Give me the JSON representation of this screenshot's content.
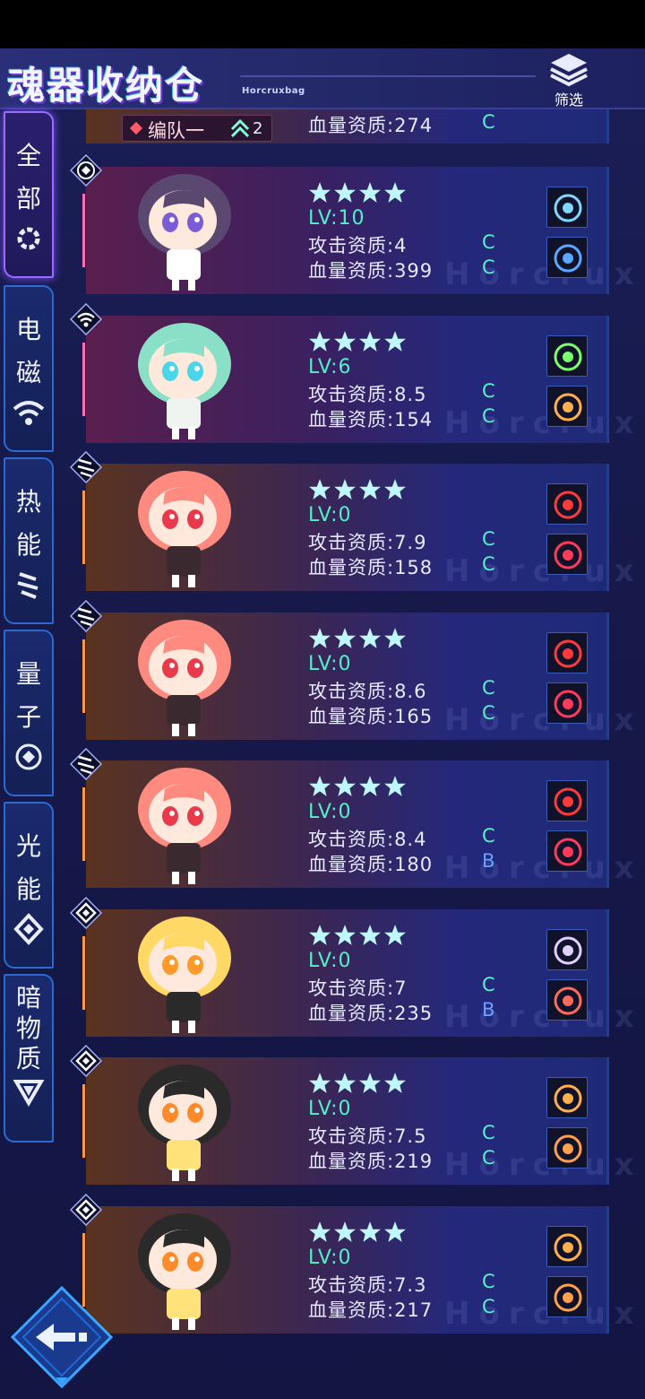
{
  "header": {
    "title": "魂器收纳仓",
    "subtitle": "Horcruxbag",
    "filter_label": "筛选"
  },
  "sidebar": {
    "tabs": [
      {
        "label": "全部",
        "icon": "all-gear-icon",
        "active": true
      },
      {
        "label": "电磁",
        "icon": "wifi-icon",
        "active": false
      },
      {
        "label": "热能",
        "icon": "heat-slashes-icon",
        "active": false
      },
      {
        "label": "量子",
        "icon": "quantum-icon",
        "active": false
      },
      {
        "label": "光能",
        "icon": "diamond-icon",
        "active": false
      },
      {
        "label": "暗物质",
        "icon": "dark-matter-icon",
        "active": false
      }
    ]
  },
  "partial_card": {
    "team_label": "编队一",
    "team_rank": "2",
    "stat_label": "血量资质:274",
    "grade": "C"
  },
  "watermark": "Horcrux",
  "cards": [
    {
      "element": "quantum-icon",
      "stars": 4,
      "level": "LV:10",
      "attack": "攻击资质:4",
      "attack_grade": "C",
      "hp": "血量资质:399",
      "hp_grade": "C",
      "skills": [
        "vortex-eye-icon",
        "shield-emblem-icon"
      ]
    },
    {
      "element": "wifi-icon",
      "stars": 4,
      "level": "LV:6",
      "attack": "攻击资质:8.5",
      "attack_grade": "C",
      "hp": "血量资质:154",
      "hp_grade": "C",
      "skills": [
        "green-gear-icon",
        "sword-up-icon"
      ]
    },
    {
      "element": "heat-slashes-icon",
      "stars": 4,
      "level": "LV:0",
      "attack": "攻击资质:7.9",
      "attack_grade": "C",
      "hp": "血量资质:158",
      "hp_grade": "C",
      "skills": [
        "red-figure-icon",
        "broken-heart-icon"
      ]
    },
    {
      "element": "heat-slashes-icon",
      "stars": 4,
      "level": "LV:0",
      "attack": "攻击资质:8.6",
      "attack_grade": "C",
      "hp": "血量资质:165",
      "hp_grade": "C",
      "skills": [
        "red-figure-icon",
        "broken-heart-icon"
      ]
    },
    {
      "element": "heat-slashes-icon",
      "stars": 4,
      "level": "LV:0",
      "attack": "攻击资质:8.4",
      "attack_grade": "C",
      "hp": "血量资质:180",
      "hp_grade": "B",
      "skills": [
        "red-figure-icon",
        "broken-heart-icon"
      ]
    },
    {
      "element": "diamond-icon",
      "stars": 4,
      "level": "LV:0",
      "attack": "攻击资质:7",
      "attack_grade": "C",
      "hp": "血量资质:235",
      "hp_grade": "B",
      "skills": [
        "purple-spirit-icon",
        "red-claw-icon"
      ]
    },
    {
      "element": "diamond-icon",
      "stars": 4,
      "level": "LV:0",
      "attack": "攻击资质:7.5",
      "attack_grade": "C",
      "hp": "血量资质:219",
      "hp_grade": "C",
      "skills": [
        "sword-up-icon",
        "crossed-swords-icon"
      ]
    },
    {
      "element": "diamond-icon",
      "stars": 4,
      "level": "LV:0",
      "attack": "攻击资质:7.3",
      "attack_grade": "C",
      "hp": "血量资质:217",
      "hp_grade": "C",
      "skills": [
        "sword-up-icon",
        "crossed-swords-icon"
      ]
    }
  ],
  "colors": {
    "accent_green": "#52f0c8",
    "grade_b": "#6aa0ff",
    "star": "#bff7ff",
    "active_tab": "#9b6bff"
  }
}
